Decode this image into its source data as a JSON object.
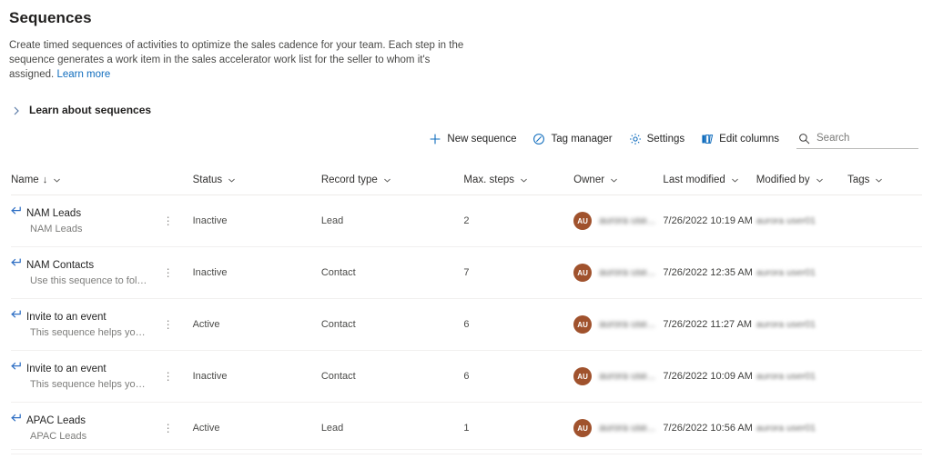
{
  "page": {
    "title": "Sequences",
    "description_part1": "Create timed sequences of activities to optimize the sales cadence for your team. Each step in the sequence generates a work item in the sales accelerator work list for the seller to whom it's assigned. ",
    "learn_more_label": "Learn more"
  },
  "expander": {
    "label": "Learn about sequences",
    "chevron_icon": "chevron-right-icon"
  },
  "toolbar": {
    "new_sequence_label": "New sequence",
    "tag_manager_label": "Tag manager",
    "settings_label": "Settings",
    "edit_columns_label": "Edit columns",
    "new_sequence_icon": "plus-icon",
    "tag_manager_icon": "tag-icon",
    "settings_icon": "gear-icon",
    "edit_columns_icon": "columns-icon",
    "accent_color": "#0f6cbd"
  },
  "search": {
    "placeholder": "Search",
    "value": "",
    "icon": "search-icon"
  },
  "table": {
    "columns": [
      {
        "label": "Name",
        "sort": "↓",
        "chevron": "chevron-down-icon"
      },
      {
        "label": "Status",
        "sort": "",
        "chevron": "chevron-down-icon"
      },
      {
        "label": "Record type",
        "sort": "",
        "chevron": "chevron-down-icon"
      },
      {
        "label": "Max. steps",
        "sort": "",
        "chevron": "chevron-down-icon"
      },
      {
        "label": "Owner",
        "sort": "",
        "chevron": "chevron-down-icon"
      },
      {
        "label": "Last modified",
        "sort": "",
        "chevron": "chevron-down-icon"
      },
      {
        "label": "Modified by",
        "sort": "",
        "chevron": "chevron-down-icon"
      },
      {
        "label": "Tags",
        "sort": "",
        "chevron": "chevron-down-icon"
      }
    ],
    "row_menu_glyph": "⋮",
    "avatar_color": "#a0522d",
    "rows": [
      {
        "name": "NAM Leads",
        "subtitle": "NAM Leads",
        "status": "Inactive",
        "record_type": "Lead",
        "max_steps": "2",
        "owner_initials": "AU",
        "owner_name": "aurora use...",
        "last_modified": "7/26/2022 10:19 AM",
        "modified_by": "aurora user01",
        "tags": ""
      },
      {
        "name": "NAM Contacts",
        "subtitle": "Use this sequence to follo...",
        "status": "Inactive",
        "record_type": "Contact",
        "max_steps": "7",
        "owner_initials": "AU",
        "owner_name": "aurora use...",
        "last_modified": "7/26/2022 12:35 AM",
        "modified_by": "aurora user01",
        "tags": ""
      },
      {
        "name": "Invite to an event",
        "subtitle": "This sequence helps you b...",
        "status": "Active",
        "record_type": "Contact",
        "max_steps": "6",
        "owner_initials": "AU",
        "owner_name": "aurora use...",
        "last_modified": "7/26/2022 11:27 AM",
        "modified_by": "aurora user01",
        "tags": ""
      },
      {
        "name": "Invite to an event",
        "subtitle": "This sequence helps you b...",
        "status": "Inactive",
        "record_type": "Contact",
        "max_steps": "6",
        "owner_initials": "AU",
        "owner_name": "aurora use...",
        "last_modified": "7/26/2022 10:09 AM",
        "modified_by": "aurora user01",
        "tags": ""
      },
      {
        "name": "APAC Leads",
        "subtitle": "APAC Leads",
        "status": "Active",
        "record_type": "Lead",
        "max_steps": "1",
        "owner_initials": "AU",
        "owner_name": "aurora use...",
        "last_modified": "7/26/2022 10:56 AM",
        "modified_by": "aurora user01",
        "tags": ""
      }
    ]
  }
}
